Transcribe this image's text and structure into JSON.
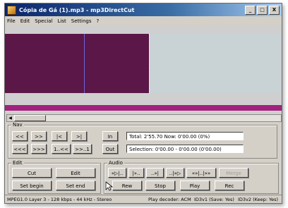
{
  "window": {
    "title": "Cópia de Gá (1).mp3 - mp3DirectCut",
    "min": "_",
    "max": "□",
    "close": "X"
  },
  "menu": [
    "File",
    "Edit",
    "Special",
    "List",
    "Settings",
    "?"
  ],
  "nav": {
    "label": "Nav",
    "row1": [
      "<<",
      ">>",
      "|<",
      ">|"
    ],
    "row2": [
      "<<<",
      ">>>",
      "1..<<",
      ">>..1"
    ],
    "in": "In",
    "out": "Out",
    "info_line1": "Total: 2'55.70  Now: 0'00.00  (0%)",
    "info_line2": "Selection: 0'00.00 - 0'00.00 (0'00.00)"
  },
  "edit": {
    "label": "Edit",
    "cut": "Cut",
    "edit": "Edit",
    "set_begin": "Set begin",
    "set_end": "Set end"
  },
  "audio": {
    "label": "Audio",
    "row1": [
      "«▷|..",
      "|»..",
      "..»|",
      "..|»▷",
      "«»|..|»»"
    ],
    "merge": "Merge",
    "rew": "Rew",
    "stop": "Stop",
    "play": "Play",
    "rec": "Rec"
  },
  "status": {
    "format": "MPEG1.0 Layer 3 - 128 kbps - 44 kHz - Stereo",
    "decoder": "Play decoder: ACM",
    "id3v1": "ID3v1 (Save: Yes)",
    "id3v2": "ID3v2 (Keep: Yes)"
  },
  "colors": {
    "selection": "#5b1747",
    "cursor": "#6a66d8",
    "bar": "#a0237e",
    "title_start": "#0a246a"
  }
}
